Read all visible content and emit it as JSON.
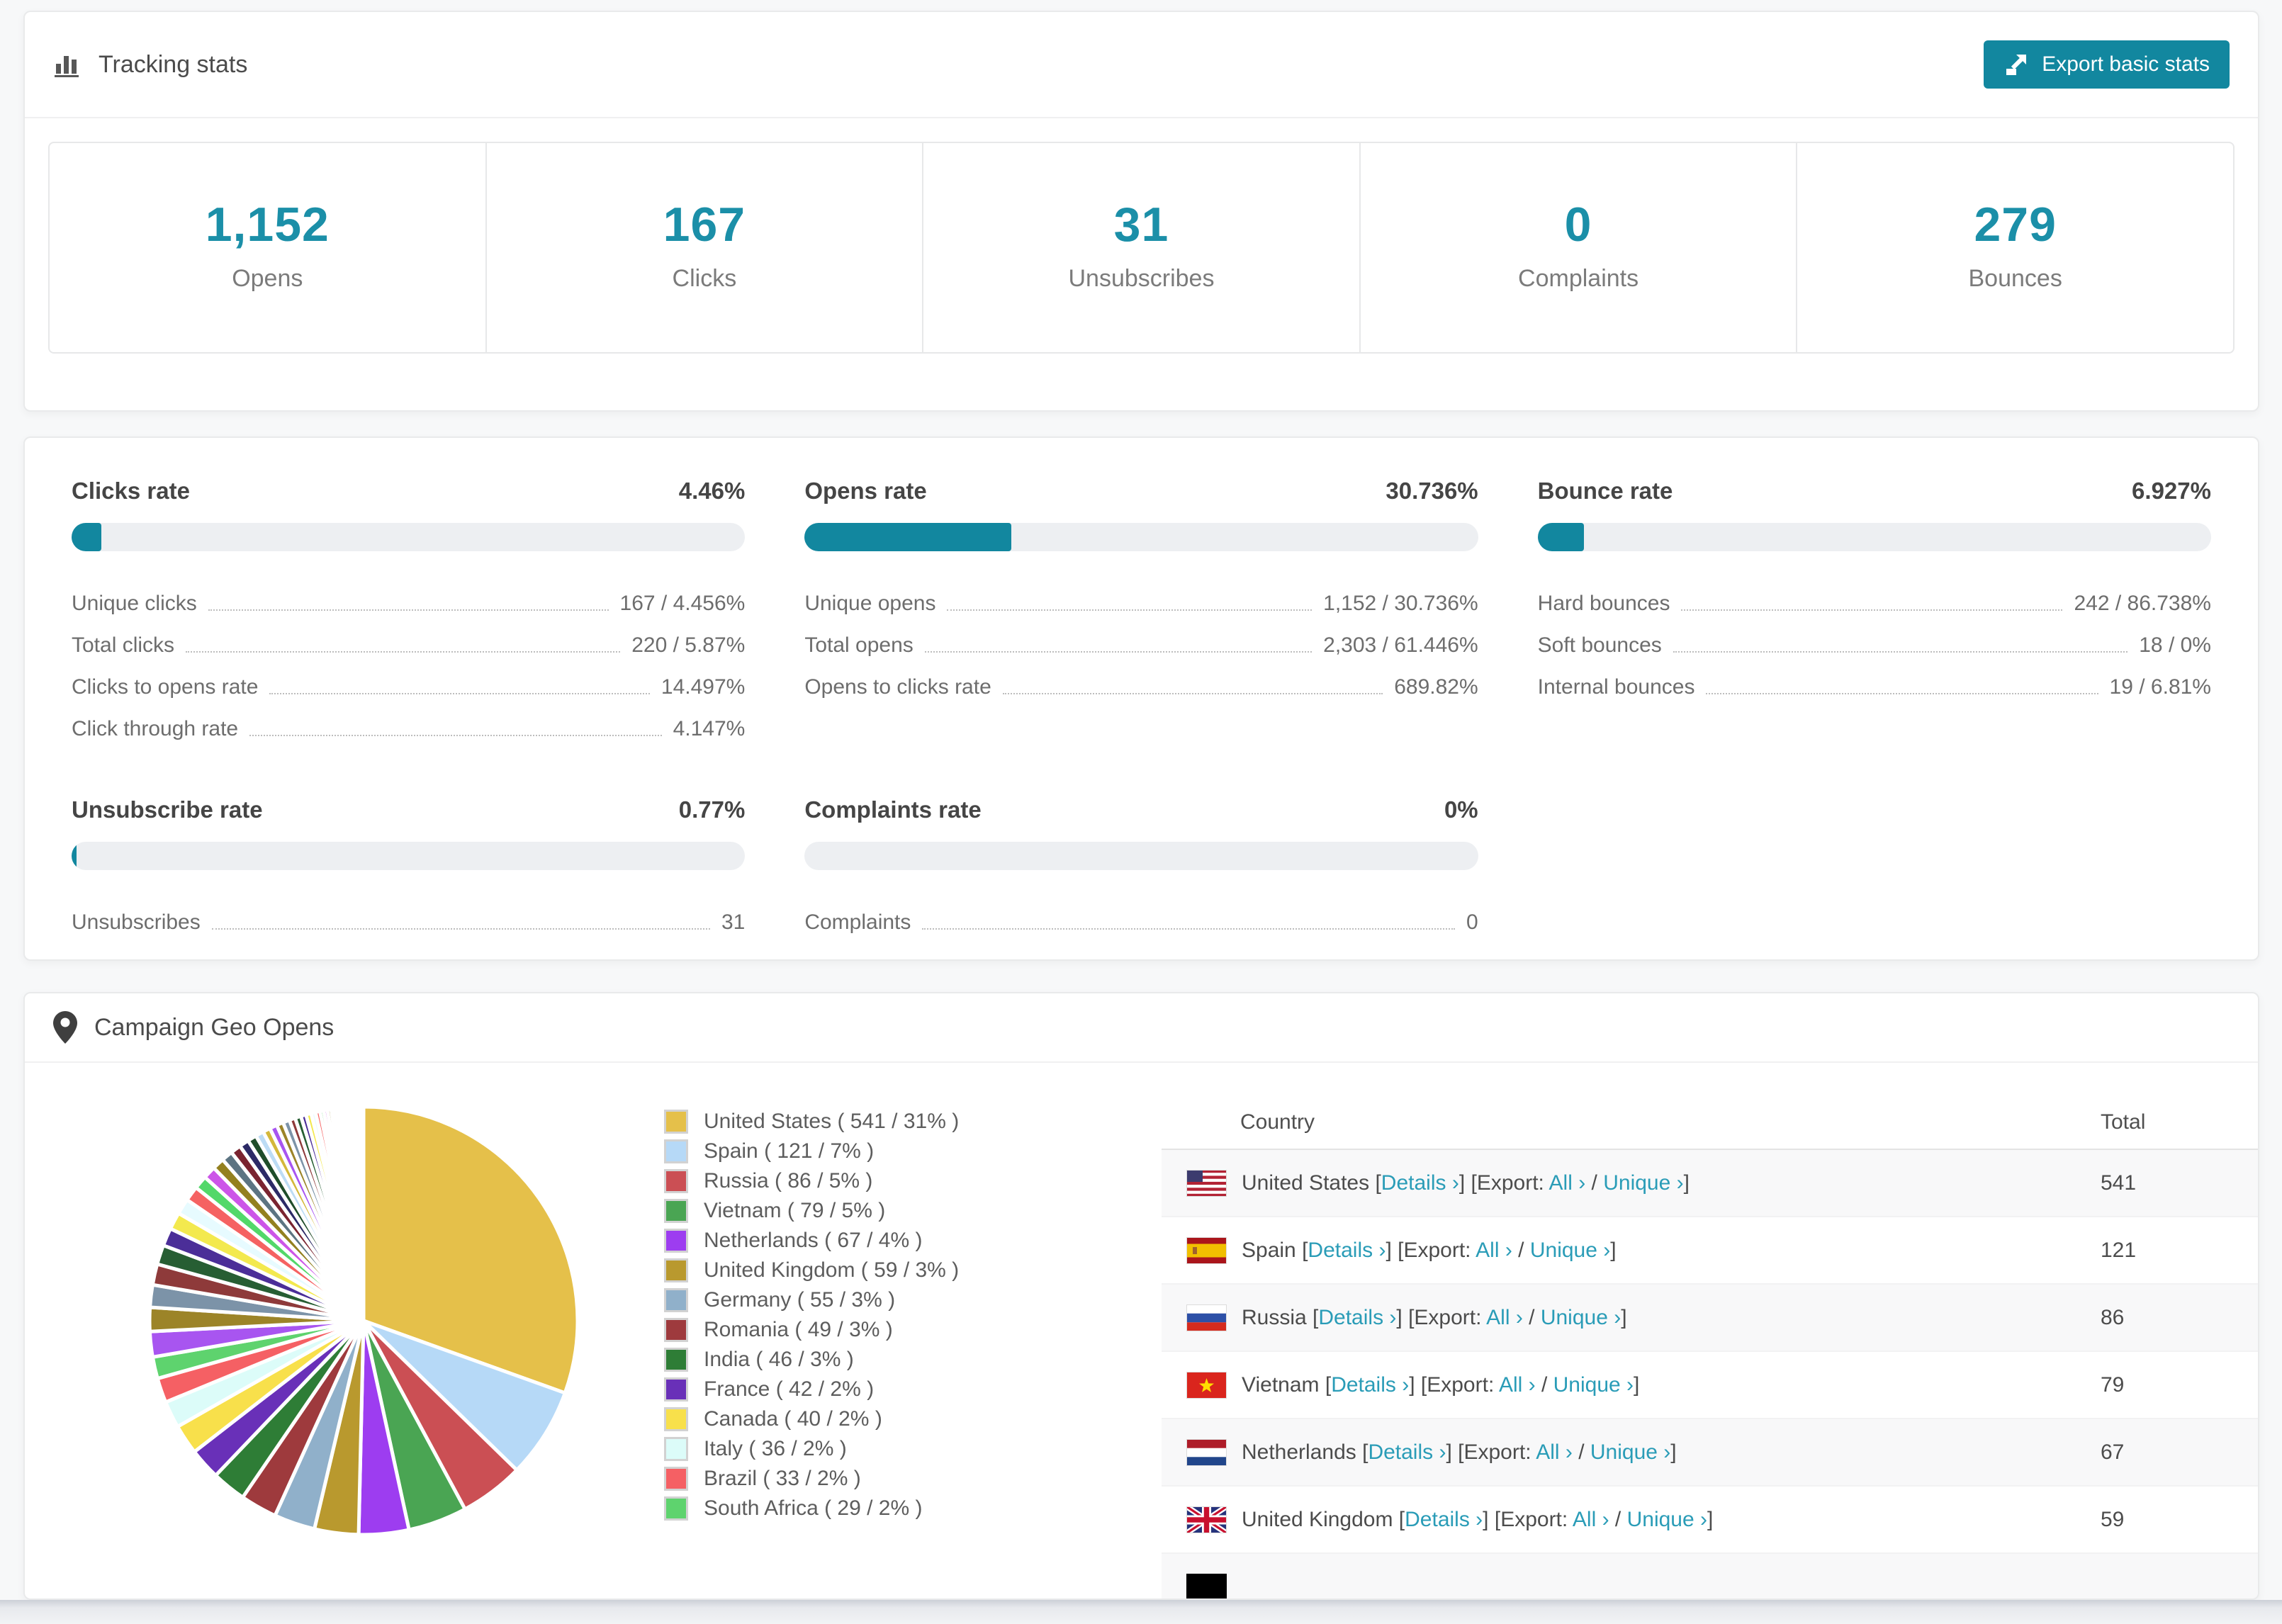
{
  "colors": {
    "accent": "#12879f",
    "stat_number": "#1b8fa8",
    "link": "#2a9cb7",
    "bar_track": "#edeff2"
  },
  "tracking": {
    "title": "Tracking stats",
    "export_button_label": "Export basic stats",
    "stats": [
      {
        "value": "1,152",
        "label": "Opens"
      },
      {
        "value": "167",
        "label": "Clicks"
      },
      {
        "value": "31",
        "label": "Unsubscribes"
      },
      {
        "value": "0",
        "label": "Complaints"
      },
      {
        "value": "279",
        "label": "Bounces"
      }
    ]
  },
  "rates": {
    "panels": [
      {
        "title": "Clicks rate",
        "value": "4.46%",
        "percent": 4.46,
        "rows": [
          {
            "label": "Unique clicks",
            "value": "167 / 4.456%"
          },
          {
            "label": "Total clicks",
            "value": "220 / 5.87%"
          },
          {
            "label": "Clicks to opens rate",
            "value": "14.497%"
          },
          {
            "label": "Click through rate",
            "value": "4.147%"
          }
        ]
      },
      {
        "title": "Opens rate",
        "value": "30.736%",
        "percent": 30.736,
        "rows": [
          {
            "label": "Unique opens",
            "value": "1,152 / 30.736%"
          },
          {
            "label": "Total opens",
            "value": "2,303 / 61.446%"
          },
          {
            "label": "Opens to clicks rate",
            "value": "689.82%"
          }
        ]
      },
      {
        "title": "Bounce rate",
        "value": "6.927%",
        "percent": 6.927,
        "rows": [
          {
            "label": "Hard bounces",
            "value": "242 / 86.738%"
          },
          {
            "label": "Soft bounces",
            "value": "18 / 0%"
          },
          {
            "label": "Internal bounces",
            "value": "19 / 6.81%"
          }
        ]
      },
      {
        "title": "Unsubscribe rate",
        "value": "0.77%",
        "percent": 0.77,
        "rows": [
          {
            "label": "Unsubscribes",
            "value": "31"
          }
        ]
      },
      {
        "title": "Complaints rate",
        "value": "0%",
        "percent": 0,
        "rows": [
          {
            "label": "Complaints",
            "value": "0"
          }
        ]
      }
    ]
  },
  "geo": {
    "title": "Campaign Geo Opens",
    "chart_data": {
      "type": "pie",
      "title": "Campaign Geo Opens",
      "unit": "opens",
      "legend_position": "right",
      "slices": [
        {
          "label": "United States",
          "value": 541,
          "pct": "31%",
          "color": "#e5c04a"
        },
        {
          "label": "Spain",
          "value": 121,
          "pct": "7%",
          "color": "#b6d9f7"
        },
        {
          "label": "Russia",
          "value": 86,
          "pct": "5%",
          "color": "#cb4f54"
        },
        {
          "label": "Vietnam",
          "value": 79,
          "pct": "5%",
          "color": "#4aa553"
        },
        {
          "label": "Netherlands",
          "value": 67,
          "pct": "4%",
          "color": "#9d3df0"
        },
        {
          "label": "United Kingdom",
          "value": 59,
          "pct": "3%",
          "color": "#b9992e"
        },
        {
          "label": "Germany",
          "value": 55,
          "pct": "3%",
          "color": "#90b0ca"
        },
        {
          "label": "Romania",
          "value": 49,
          "pct": "3%",
          "color": "#9e3a3d"
        },
        {
          "label": "India",
          "value": 46,
          "pct": "3%",
          "color": "#2e7d36"
        },
        {
          "label": "France",
          "value": 42,
          "pct": "2%",
          "color": "#6930b8"
        },
        {
          "label": "Canada",
          "value": 40,
          "pct": "2%",
          "color": "#f8e04b"
        },
        {
          "label": "Italy",
          "value": 36,
          "pct": "2%",
          "color": "#dcfcf9"
        },
        {
          "label": "Brazil",
          "value": 33,
          "pct": "2%",
          "color": "#f56064"
        },
        {
          "label": "South Africa",
          "value": 29,
          "pct": "2%",
          "color": "#5ed36e"
        }
      ],
      "other_slices": {
        "note": "unlabeled long tail of smaller countries",
        "values": [
          34,
          32,
          30,
          28,
          26,
          24,
          23,
          21,
          20,
          18,
          17,
          16,
          15,
          14,
          13,
          12,
          11,
          10,
          10,
          9,
          9,
          8,
          8,
          7,
          7,
          6,
          6,
          5,
          5,
          5,
          4,
          4,
          4,
          3,
          3,
          3,
          3,
          2,
          2,
          2,
          2,
          2,
          2,
          1,
          1,
          1,
          1,
          1,
          1,
          1
        ],
        "palette": [
          "#a855f0",
          "#9c8428",
          "#7c93a8",
          "#8e3a3a",
          "#275e33",
          "#4b2e98",
          "#f3e94e",
          "#e7fbff",
          "#f56262",
          "#52d869",
          "#cc55e8",
          "#93801f",
          "#5c7482",
          "#7a2430",
          "#2c2a66",
          "#1f4d2a",
          "#bcdcf5",
          "#d4b83a"
        ]
      }
    },
    "legend": [
      {
        "text": "United States ( 541 / 31% )",
        "color": "#e5c04a"
      },
      {
        "text": "Spain ( 121 / 7% )",
        "color": "#b6d9f7"
      },
      {
        "text": "Russia ( 86 / 5% )",
        "color": "#cb4f54"
      },
      {
        "text": "Vietnam ( 79 / 5% )",
        "color": "#4aa553"
      },
      {
        "text": "Netherlands ( 67 / 4% )",
        "color": "#9d3df0"
      },
      {
        "text": "United Kingdom ( 59 / 3% )",
        "color": "#b9992e"
      },
      {
        "text": "Germany ( 55 / 3% )",
        "color": "#90b0ca"
      },
      {
        "text": "Romania ( 49 / 3% )",
        "color": "#9e3a3d"
      },
      {
        "text": "India ( 46 / 3% )",
        "color": "#2e7d36"
      },
      {
        "text": "France ( 42 / 2% )",
        "color": "#6930b8"
      },
      {
        "text": "Canada ( 40 / 2% )",
        "color": "#f8e04b"
      },
      {
        "text": "Italy ( 36 / 2% )",
        "color": "#dcfcf9"
      },
      {
        "text": "Brazil ( 33 / 2% )",
        "color": "#f56064"
      },
      {
        "text": "South Africa ( 29 / 2% )",
        "color": "#5ed36e"
      }
    ],
    "table": {
      "columns": [
        "Country",
        "Total"
      ],
      "details_label": "Details ›",
      "export_label": "Export:",
      "all_label": "All ›",
      "unique_label": "Unique ›",
      "rows": [
        {
          "country": "United States",
          "flag": "us",
          "total": "541",
          "partial": false
        },
        {
          "country": "Spain",
          "flag": "es",
          "total": "121",
          "partial": false
        },
        {
          "country": "Russia",
          "flag": "ru",
          "total": "86",
          "partial": false
        },
        {
          "country": "Vietnam",
          "flag": "vn",
          "total": "79",
          "partial": false
        },
        {
          "country": "Netherlands",
          "flag": "nl",
          "total": "67",
          "partial": false
        },
        {
          "country": "United Kingdom",
          "flag": "gb",
          "total": "59",
          "partial": false
        },
        {
          "country": "",
          "flag": "partial",
          "total": "",
          "partial": true
        }
      ]
    }
  }
}
